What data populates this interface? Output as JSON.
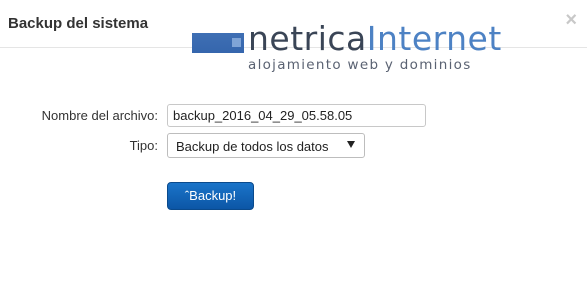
{
  "modal": {
    "title": "Backup del sistema",
    "close_label": "×"
  },
  "logo": {
    "name_part1": "netrica",
    "name_part2": "Internet",
    "tagline": "alojamiento web y dominios",
    "colors": {
      "dark": "#3a4556",
      "blue": "#4d82c4",
      "box": "#3566ad"
    }
  },
  "form": {
    "filename_label": "Nombre del archivo:",
    "filename_value": "backup_2016_04_29_05.58.05",
    "type_label": "Tipo:",
    "type_selected": "Backup de todos los datos",
    "submit_label": "ˆBackup!"
  },
  "colors": {
    "button": "#0c56a6",
    "title": "#333333"
  }
}
